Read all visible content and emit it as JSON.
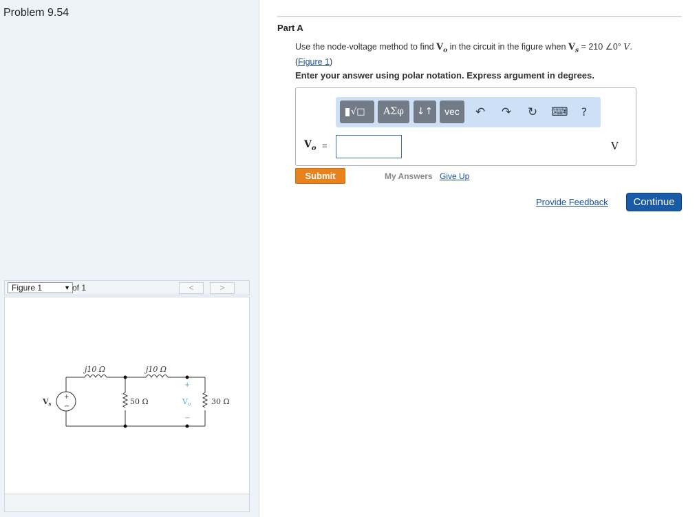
{
  "problem": {
    "title": "Problem 9.54"
  },
  "figure_nav": {
    "selected": "Figure 1",
    "of_text": "of 1",
    "prev": "<",
    "next": ">"
  },
  "circuit": {
    "source_label": "V",
    "source_sub": "s",
    "inductor1": "j10 Ω",
    "inductor2": "j10 Ω",
    "resistor_mid": "50 Ω",
    "resistor_right": "30 Ω",
    "output_label": "V",
    "output_sub": "o",
    "plus": "+",
    "minus": "−"
  },
  "part": {
    "title": "Part A",
    "question_pre": "Use the node-voltage method to find ",
    "question_var": "V",
    "question_var_sub": "o",
    "question_mid": " in the circuit in the figure when ",
    "question_src": "V",
    "question_src_sub": "s",
    "question_value": " = 210 ∠0° ",
    "question_unit": "V",
    "question_end": ".",
    "figure_link": "Figure 1",
    "instruction": "Enter your answer using polar notation. Express argument in degrees."
  },
  "toolbar": {
    "templates": "√□",
    "greek": "ΑΣφ",
    "arrows": "↓↑",
    "vec": "vec",
    "undo": "↶",
    "redo": "↷",
    "reset": "↻",
    "keyboard": "⌨",
    "help": "?"
  },
  "answer": {
    "label": "V",
    "label_sub": "o",
    "equals": "=",
    "value": "",
    "unit": "V"
  },
  "actions": {
    "submit": "Submit",
    "my_answers": "My Answers",
    "give_up": "Give Up",
    "provide_feedback": "Provide Feedback",
    "continue": "Continue"
  }
}
